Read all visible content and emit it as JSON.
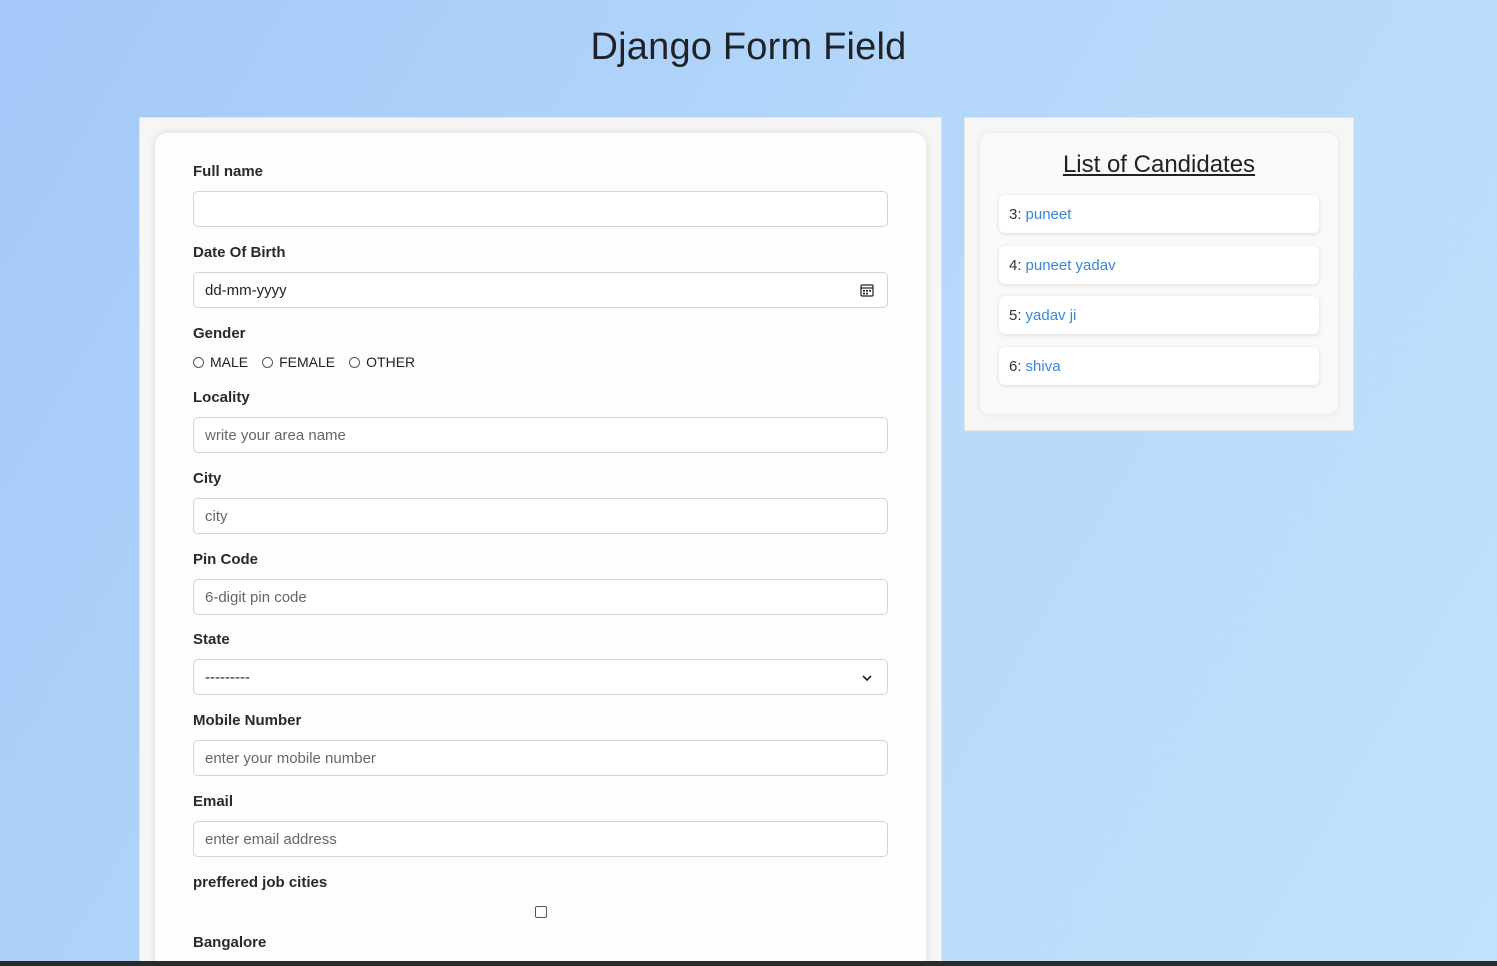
{
  "page": {
    "title": "Django Form Field"
  },
  "form": {
    "full_name": {
      "label": "Full name",
      "value": "",
      "placeholder": ""
    },
    "dob": {
      "label": "Date Of Birth",
      "value": "dd-mm-yyyy",
      "icon": "calendar-icon"
    },
    "gender": {
      "label": "Gender",
      "options": [
        "MALE",
        "FEMALE",
        "OTHER"
      ]
    },
    "locality": {
      "label": "Locality",
      "value": "",
      "placeholder": "write your area name"
    },
    "city": {
      "label": "City",
      "value": "",
      "placeholder": "city"
    },
    "pin_code": {
      "label": "Pin Code",
      "value": "",
      "placeholder": "6-digit pin code"
    },
    "state": {
      "label": "State",
      "value": "---------",
      "icon": "chevron-down-icon"
    },
    "mobile": {
      "label": "Mobile Number",
      "value": "",
      "placeholder": "enter your mobile number"
    },
    "email": {
      "label": "Email",
      "value": "",
      "placeholder": "enter email address"
    },
    "job_cities": {
      "label": "preffered job cities",
      "first_option": "Bangalore"
    }
  },
  "candidates": {
    "title": "List of Candidates",
    "items": [
      {
        "id": "3:",
        "name": "puneet"
      },
      {
        "id": "4:",
        "name": "puneet yadav"
      },
      {
        "id": "5:",
        "name": "yadav ji"
      },
      {
        "id": "6:",
        "name": "shiva"
      }
    ]
  },
  "colors": {
    "background_start": "#a4c8f8",
    "background_end": "#c2e2fb",
    "link": "#3a86d6"
  }
}
